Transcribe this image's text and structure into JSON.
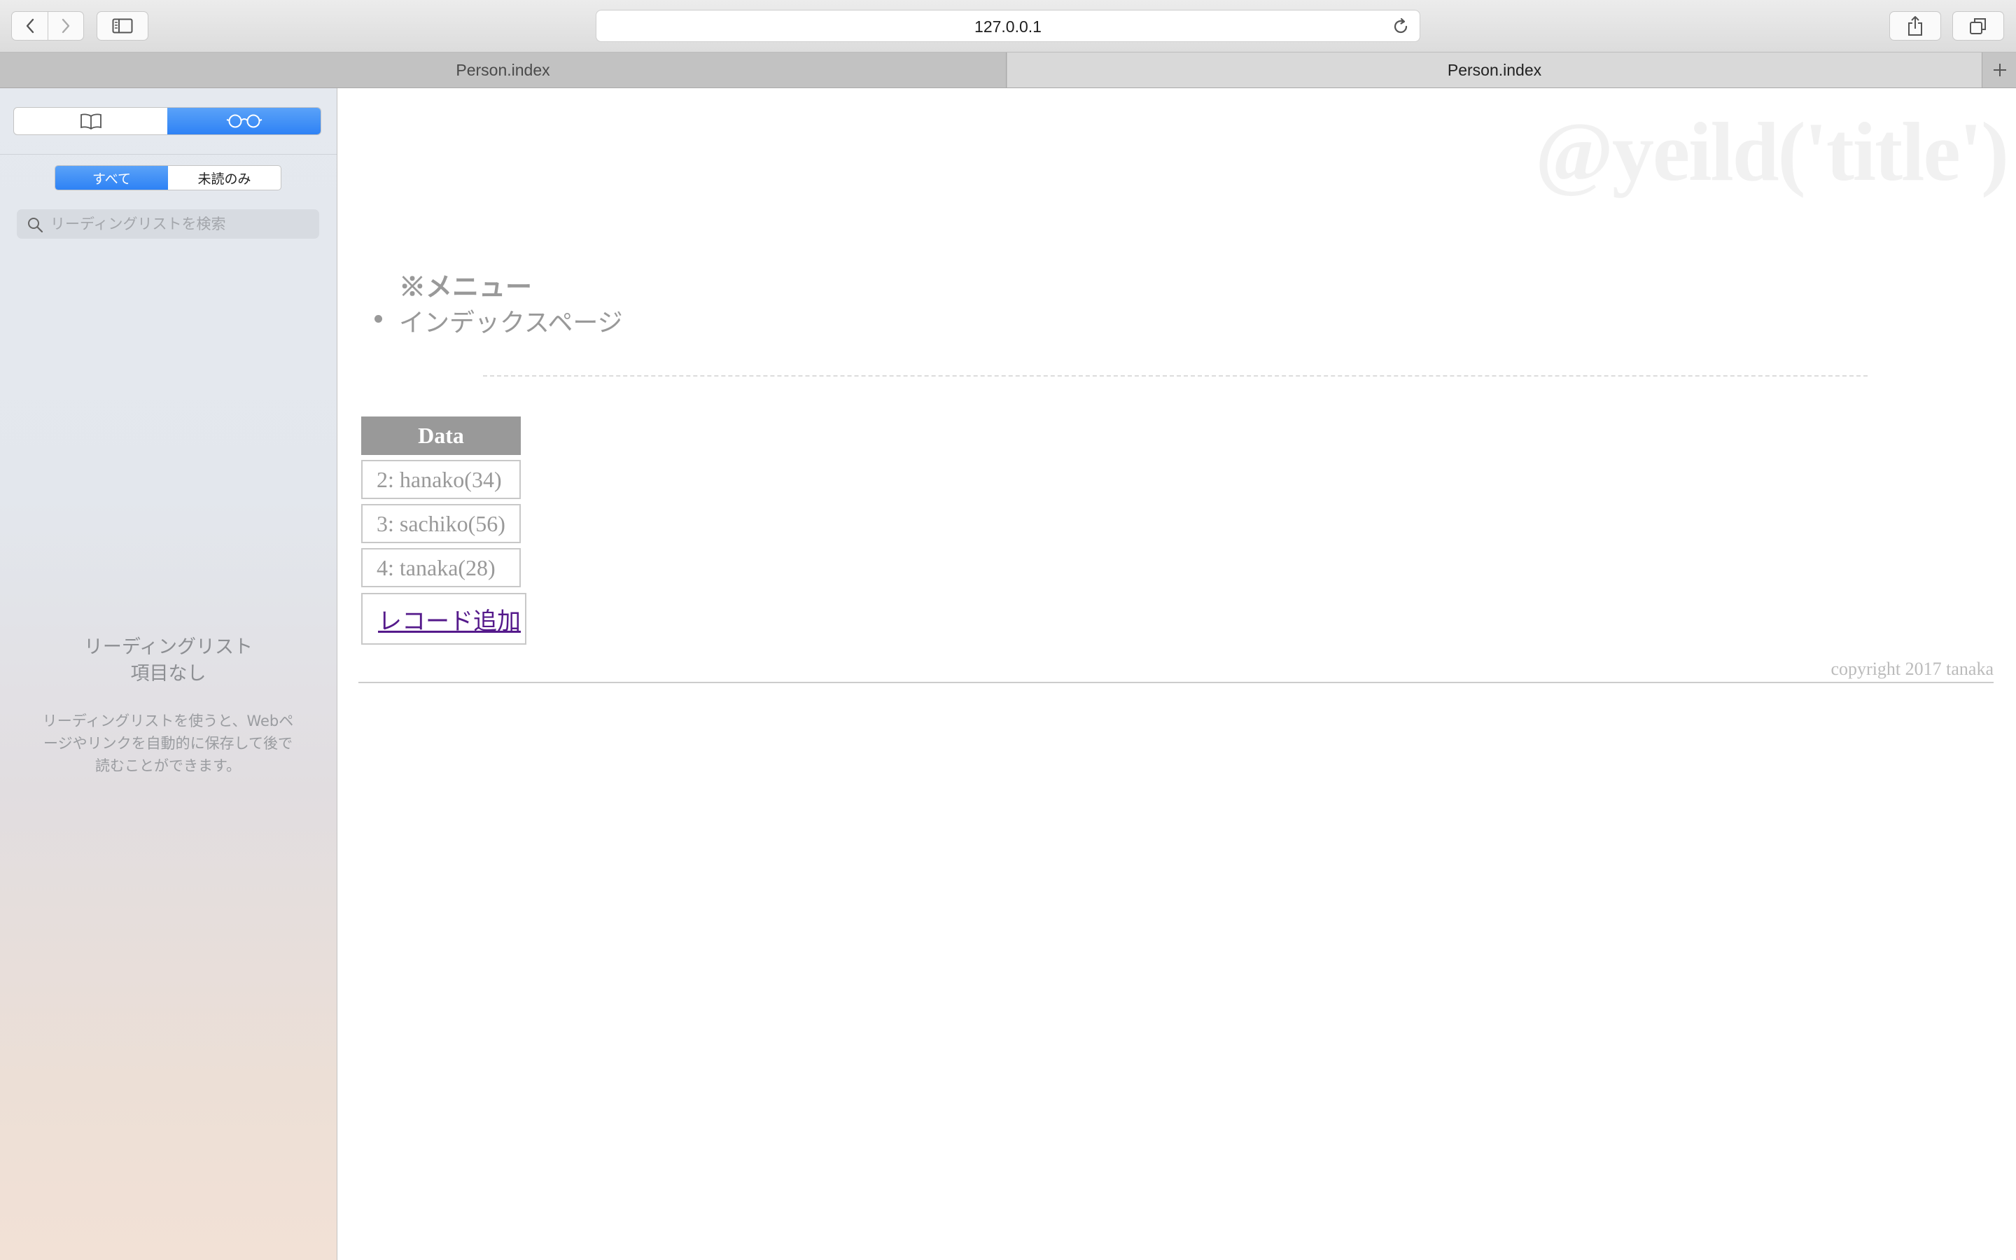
{
  "browser": {
    "url": "127.0.0.1",
    "tabs": [
      {
        "label": "Person.index",
        "active": false
      },
      {
        "label": "Person.index",
        "active": true
      }
    ],
    "toolbar_icons": [
      "back-icon",
      "forward-icon",
      "sidebar-icon",
      "reload-icon",
      "share-icon",
      "tabs-overview-icon",
      "new-tab-icon"
    ]
  },
  "sidebar": {
    "segments": [
      {
        "icon": "bookmarks-book-icon",
        "active": false
      },
      {
        "icon": "reading-list-glasses-icon",
        "active": true
      }
    ],
    "filter": {
      "all_label": "すべて",
      "unread_label": "未読のみ",
      "selected": "すべて"
    },
    "search_placeholder": "リーディングリストを検索",
    "empty_title_line1": "リーディングリスト",
    "empty_title_line2": "項目なし",
    "empty_desc_line1": "リーディングリストを使うと、Webペ",
    "empty_desc_line2": "ージやリンクを自動的に保存して後で",
    "empty_desc_line3": "読むことができます。"
  },
  "page": {
    "title": "@yeild('title')",
    "menu_heading": "※メニュー",
    "menu_items": [
      "インデックスページ"
    ],
    "table": {
      "header": "Data",
      "rows": [
        "2: hanako(34)",
        "3: sachiko(56)",
        "4: tanaka(28)"
      ]
    },
    "add_record_label": "レコード追加",
    "copyright": "copyright 2017 tanaka"
  },
  "colors": {
    "accent_blue": "#2e82f5",
    "table_header_bg": "#999999",
    "link_visited": "#551a8b"
  }
}
